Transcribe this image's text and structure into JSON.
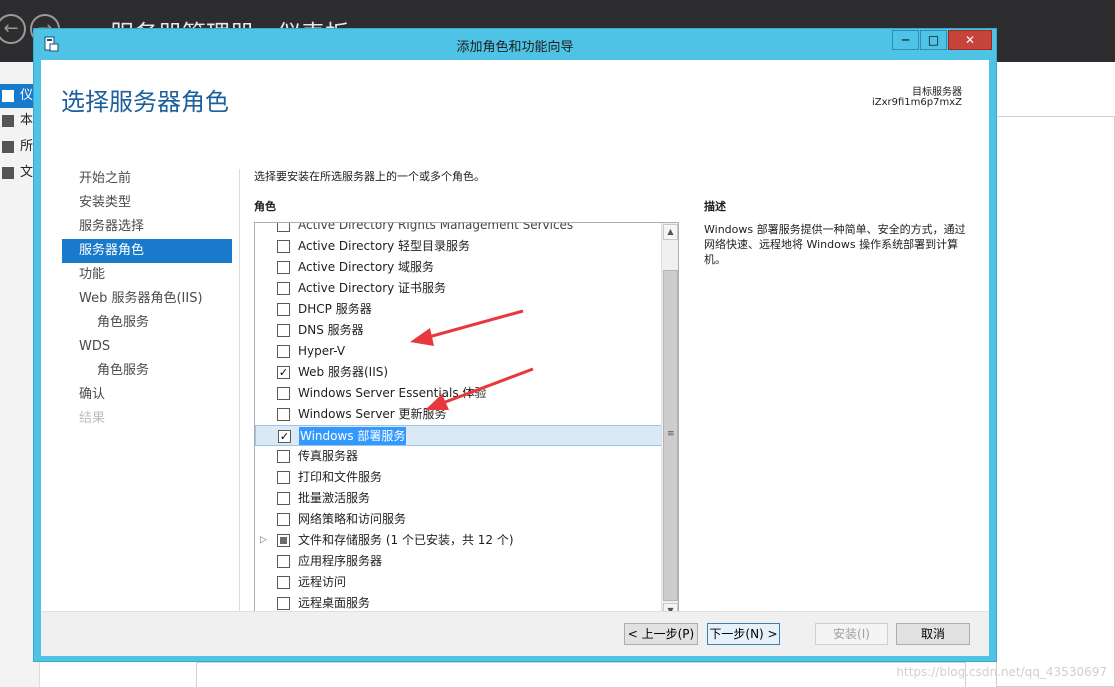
{
  "background": {
    "title": "服务器管理器 · 仪表板",
    "sidebar": [
      {
        "label": "仪",
        "active": true
      },
      {
        "label": "本",
        "active": false
      },
      {
        "label": "所",
        "active": false
      },
      {
        "label": "文",
        "active": false
      }
    ]
  },
  "dialog": {
    "title": "添加角色和功能向导",
    "page_title": "选择服务器角色",
    "target_label": "目标服务器",
    "target_value": "iZxr9fi1m6p7mxZ",
    "nav": [
      {
        "label": "开始之前",
        "sub": false,
        "state": "normal"
      },
      {
        "label": "安装类型",
        "sub": false,
        "state": "normal"
      },
      {
        "label": "服务器选择",
        "sub": false,
        "state": "normal"
      },
      {
        "label": "服务器角色",
        "sub": false,
        "state": "active"
      },
      {
        "label": "功能",
        "sub": false,
        "state": "normal"
      },
      {
        "label": "Web 服务器角色(IIS)",
        "sub": false,
        "state": "normal"
      },
      {
        "label": "角色服务",
        "sub": true,
        "state": "normal"
      },
      {
        "label": "WDS",
        "sub": false,
        "state": "normal"
      },
      {
        "label": "角色服务",
        "sub": true,
        "state": "normal"
      },
      {
        "label": "确认",
        "sub": false,
        "state": "normal"
      },
      {
        "label": "结果",
        "sub": false,
        "state": "disabled"
      }
    ],
    "instruction": "选择要安装在所选服务器上的一个或多个角色。",
    "roles_header": "角色",
    "description_header": "描述",
    "description": "Windows 部署服务提供一种简单、安全的方式，通过网络快速、远程地将 Windows 操作系统部署到计算机。",
    "roles_clipped": "Active Directory Rights Management Services",
    "roles": [
      {
        "label": "Active Directory 轻型目录服务",
        "state": "unchecked"
      },
      {
        "label": "Active Directory 域服务",
        "state": "unchecked"
      },
      {
        "label": "Active Directory 证书服务",
        "state": "unchecked"
      },
      {
        "label": "DHCP 服务器",
        "state": "unchecked"
      },
      {
        "label": "DNS 服务器",
        "state": "unchecked"
      },
      {
        "label": "Hyper-V",
        "state": "unchecked"
      },
      {
        "label": "Web 服务器(IIS)",
        "state": "checked"
      },
      {
        "label": "Windows Server Essentials 体验",
        "state": "unchecked"
      },
      {
        "label": "Windows Server 更新服务",
        "state": "unchecked"
      },
      {
        "label": "Windows 部署服务",
        "state": "checked",
        "selected": true
      },
      {
        "label": "传真服务器",
        "state": "unchecked"
      },
      {
        "label": "打印和文件服务",
        "state": "unchecked"
      },
      {
        "label": "批量激活服务",
        "state": "unchecked"
      },
      {
        "label": "网络策略和访问服务",
        "state": "unchecked"
      },
      {
        "label": "文件和存储服务 (1 个已安装，共 12 个)",
        "state": "partial",
        "expandable": true
      },
      {
        "label": "应用程序服务器",
        "state": "unchecked"
      },
      {
        "label": "远程访问",
        "state": "unchecked"
      },
      {
        "label": "远程桌面服务",
        "state": "unchecked"
      }
    ],
    "buttons": {
      "prev": "< 上一步(P)",
      "next": "下一步(N) >",
      "install": "安装(I)",
      "cancel": "取消"
    }
  },
  "watermark": "https://blog.csdn.net/qq_43530697",
  "colors": {
    "dialog_border": "#4fc3e6",
    "accent": "#1979ca",
    "title_blue": "#1d5f9c",
    "annotation": "#e8383d"
  }
}
